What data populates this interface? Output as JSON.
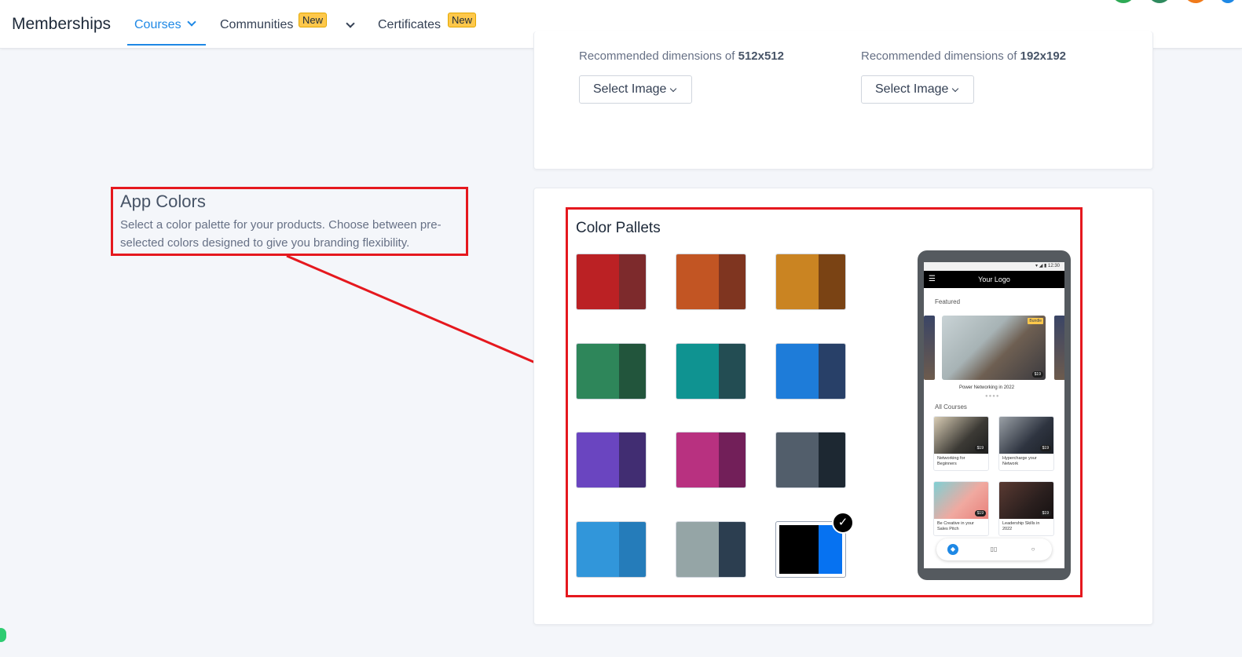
{
  "nav": {
    "brand": "Memberships",
    "courses": "Courses",
    "communities": "Communities",
    "certificates": "Certificates",
    "new_badge": "New"
  },
  "upload": {
    "left": {
      "prefix": "Recommended dimensions of ",
      "size": "512x512",
      "button": "Select Image"
    },
    "right": {
      "prefix": "Recommended dimensions of ",
      "size": "192x192",
      "button": "Select Image"
    }
  },
  "section": {
    "title": "App Colors",
    "description": "Select a color palette for your products. Choose between pre-selected colors designed to give you branding flexibility."
  },
  "palettes": {
    "title": "Color Pallets",
    "selected_index": 11,
    "items": [
      {
        "primary": "#bb2124",
        "secondary": "#7d2a2c"
      },
      {
        "primary": "#c25523",
        "secondary": "#7f3520"
      },
      {
        "primary": "#ca8422",
        "secondary": "#7a4314"
      },
      {
        "primary": "#2e865a",
        "secondary": "#22553c"
      },
      {
        "primary": "#0f9391",
        "secondary": "#234d53"
      },
      {
        "primary": "#1e7cd9",
        "secondary": "#284068"
      },
      {
        "primary": "#6a45c0",
        "secondary": "#412d72"
      },
      {
        "primary": "#b83180",
        "secondary": "#721f59"
      },
      {
        "primary": "#525e6b",
        "secondary": "#1d2832"
      },
      {
        "primary": "#3196da",
        "secondary": "#257cba"
      },
      {
        "primary": "#95a5a6",
        "secondary": "#2c3e50"
      },
      {
        "primary": "#000000",
        "secondary": "#0672f1"
      }
    ]
  },
  "phone": {
    "time": "12:30",
    "logo": "Your Logo",
    "featured_label": "Featured",
    "bundle_badge": "Bundle",
    "featured_price": "$19",
    "featured_title": "Power Networking in 2022",
    "all_courses_label": "All Courses",
    "courses": [
      {
        "title": "Networking for Beginners",
        "price": "$19"
      },
      {
        "title": "Hypercharge your Network",
        "price": "$19"
      },
      {
        "title": "Be Creative in your Sales Pitch",
        "price": "$19"
      },
      {
        "title": "Leadership Skills in 2022",
        "price": "$19"
      }
    ]
  },
  "icons": {
    "courses_chevron": "chevron-down-icon",
    "communities_chevron": "chevron-down-icon",
    "select_chevron": "chevron-down-icon",
    "check": "check-icon",
    "arrow": "annotation-arrow",
    "menu": "hamburger-icon"
  },
  "colors": {
    "accent": "#1e88e5",
    "annotation": "#e5181e",
    "badge": "#fec84b"
  }
}
